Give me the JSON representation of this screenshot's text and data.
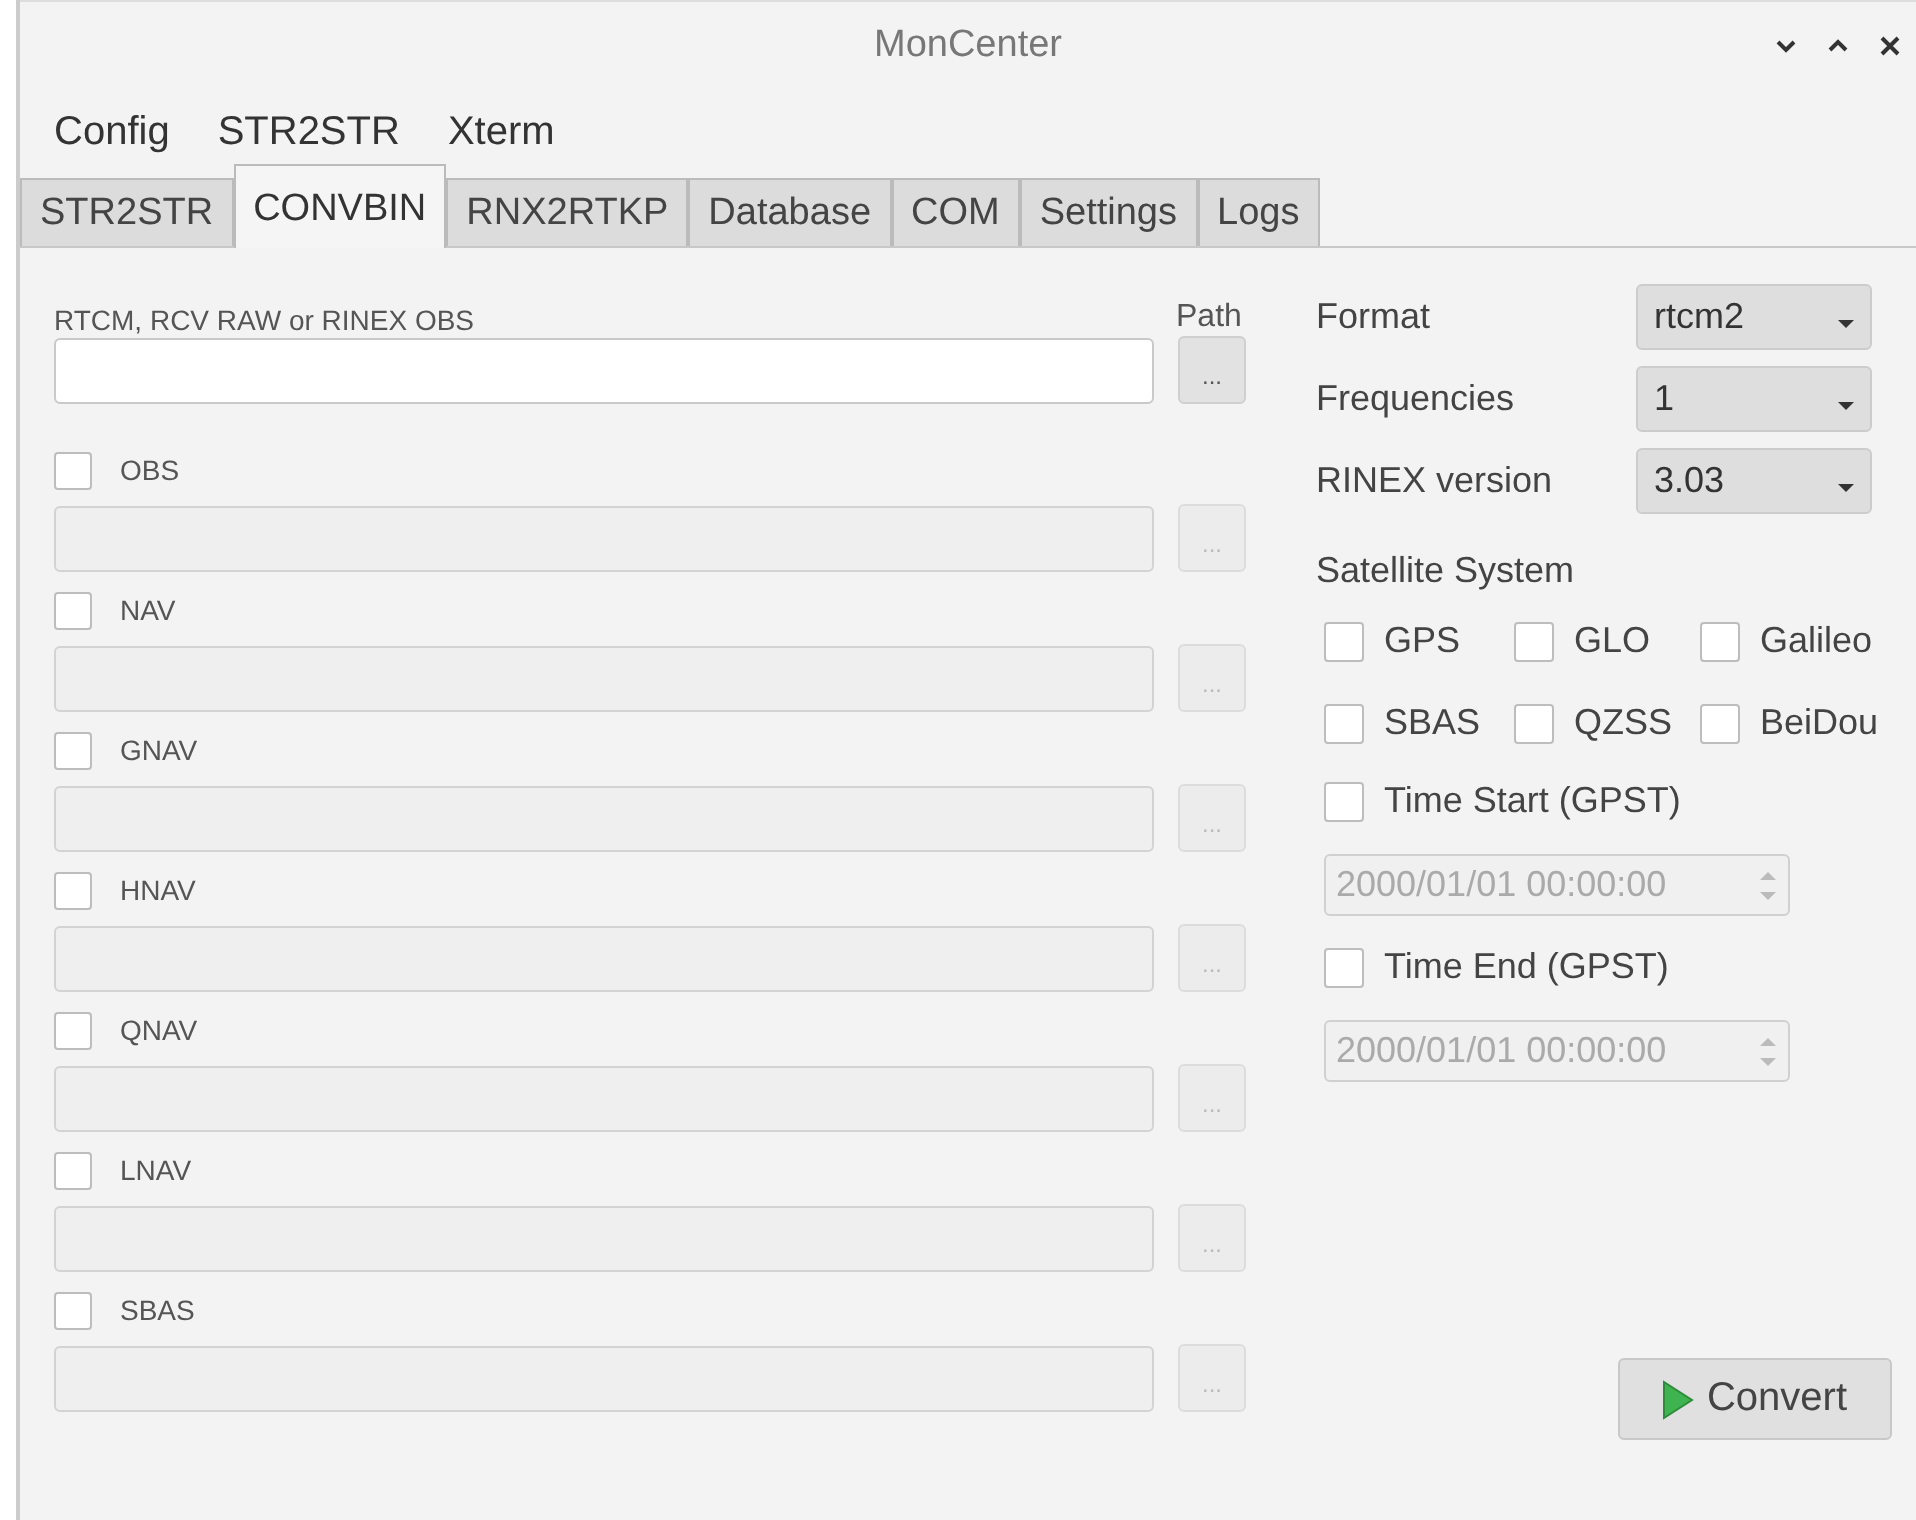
{
  "window": {
    "title": "MonCenter"
  },
  "menu": [
    "Config",
    "STR2STR",
    "Xterm"
  ],
  "tabs": [
    {
      "label": "STR2STR",
      "selected": false
    },
    {
      "label": "CONVBIN",
      "selected": true
    },
    {
      "label": "RNX2RTKP",
      "selected": false
    },
    {
      "label": "Database",
      "selected": false
    },
    {
      "label": "COM",
      "selected": false
    },
    {
      "label": "Settings",
      "selected": false
    },
    {
      "label": "Logs",
      "selected": false
    }
  ],
  "input": {
    "label": "RTCM, RCV RAW or RINEX OBS",
    "path_label": "Path",
    "button": "..."
  },
  "outputs": [
    {
      "label": "OBS",
      "checked": false,
      "disabled": true,
      "button": "..."
    },
    {
      "label": "NAV",
      "checked": false,
      "disabled": true,
      "button": "..."
    },
    {
      "label": "GNAV",
      "checked": false,
      "disabled": true,
      "button": "..."
    },
    {
      "label": "HNAV",
      "checked": false,
      "disabled": true,
      "button": "..."
    },
    {
      "label": "QNAV",
      "checked": false,
      "disabled": true,
      "button": "..."
    },
    {
      "label": "LNAV",
      "checked": false,
      "disabled": true,
      "button": "..."
    },
    {
      "label": "SBAS",
      "checked": false,
      "disabled": true,
      "button": "..."
    }
  ],
  "options": [
    {
      "label": "Format",
      "value": "rtcm2"
    },
    {
      "label": "Frequencies",
      "value": "1"
    },
    {
      "label": "RINEX version",
      "value": "3.03"
    }
  ],
  "satellite_system": {
    "title": "Satellite System",
    "systems": [
      {
        "label": "GPS",
        "checked": false
      },
      {
        "label": "GLO",
        "checked": false
      },
      {
        "label": "Galileo",
        "checked": false
      },
      {
        "label": "SBAS",
        "checked": false
      },
      {
        "label": "QZSS",
        "checked": false
      },
      {
        "label": "BeiDou",
        "checked": false
      }
    ]
  },
  "times": [
    {
      "label": "Time Start (GPST)",
      "checked": false,
      "value": "2000/01/01 00:00:00",
      "disabled": true
    },
    {
      "label": "Time End (GPST)",
      "checked": false,
      "value": "2000/01/01 00:00:00",
      "disabled": true
    }
  ],
  "convert_button": "Convert"
}
